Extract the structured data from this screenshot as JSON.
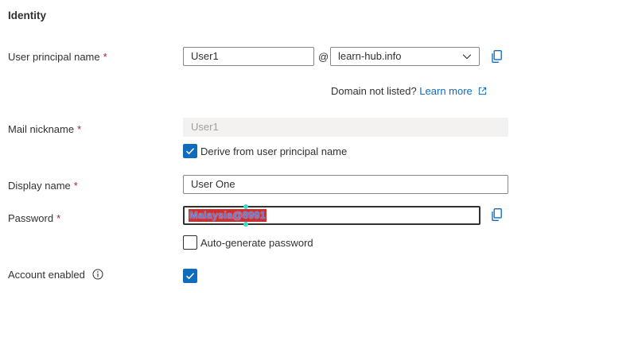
{
  "section": {
    "title": "Identity"
  },
  "upn": {
    "label": "User principal name",
    "required": "*",
    "value": "User1",
    "at": "@",
    "domain": "learn-hub.info",
    "domain_not_listed": "Domain not listed?",
    "learn_more": "Learn more"
  },
  "mail_nickname": {
    "label": "Mail nickname",
    "required": "*",
    "value": "User1",
    "derive_label": "Derive from user principal name",
    "derive_checked": true
  },
  "display_name": {
    "label": "Display name",
    "required": "*",
    "value": "User One"
  },
  "password": {
    "label": "Password",
    "required": "*",
    "value": "Malaysia@8991",
    "auto_generate_label": "Auto-generate password",
    "auto_generate_checked": false
  },
  "account_enabled": {
    "label": "Account enabled",
    "checked": true
  },
  "icons": {
    "copy": "copy-icon",
    "chevron": "chevron-down-icon",
    "external": "external-link-icon",
    "info": "info-icon",
    "check": "checkmark-icon"
  },
  "colors": {
    "accent": "#0f6cbd",
    "required": "#a4262c",
    "text": "#323130"
  }
}
